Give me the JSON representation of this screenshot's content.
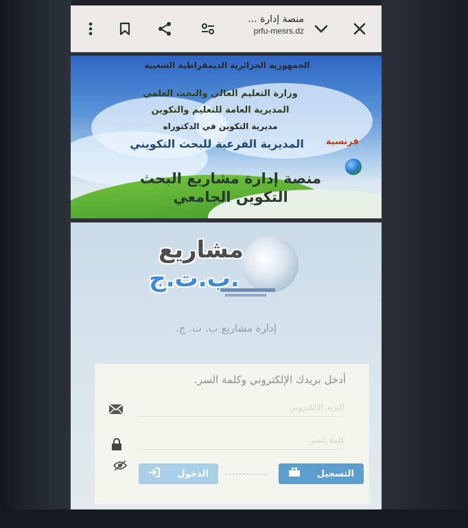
{
  "browser": {
    "page_title": "منصة إدارة ...",
    "host": "prfu-mesrs.dz",
    "icons": [
      "menu-dots-icon",
      "bookmark-icon",
      "share-icon",
      "settings-sliders-icon",
      "chevron-down-icon",
      "close-icon"
    ]
  },
  "banner": {
    "line1": "الجمهورية الجزائرية الديمقراطية الشعبية",
    "line2": "وزارة التعليم العالي والبحث العلمي",
    "line3": "المديرية العامة للتعليم والتكوين",
    "line4": "مديرية التكوين في الدكتوراه",
    "line5": "المديرية الفرعية للبحث التكويني",
    "title": "منصة إدارة مشاريع البحث التكوين الجامعي",
    "language_link": "فرنسية"
  },
  "logo": {
    "word": "مشاريع",
    "abbreviation": "ب.ت.ج."
  },
  "subtitle": "إدارة مشاريع ب. ت. ج.",
  "login": {
    "message": "أدخل بريدك الإلكتروني وكلمة السر.",
    "email_placeholder": "البريد الإلكتروني",
    "password_placeholder": "كلمة السر",
    "login_label": "الدخول",
    "register_label": "التسجيل"
  },
  "colors": {
    "register_button": "#5b9ecf",
    "login_button": "#a9cfe6",
    "language_link": "#b13c1c"
  }
}
